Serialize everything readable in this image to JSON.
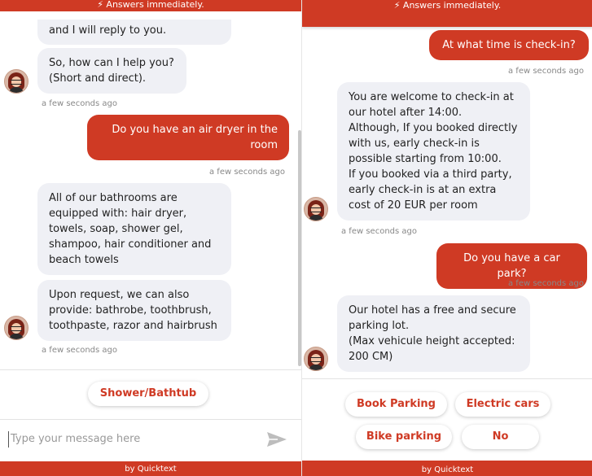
{
  "left": {
    "header": {
      "text": "⚡ Answers immediately."
    },
    "messages": {
      "bot_partial": "and I will reply to you.",
      "bot_help": "So, how can I help you?\n(Short and direct).",
      "time1": "a few seconds ago",
      "user_q": "Do you have an air dryer in the room",
      "time2": "a few seconds ago",
      "bot_bath": "All of our bathrooms are equipped with: hair dryer, towels, soap, shower gel, shampoo, hair conditioner and beach towels",
      "bot_request": "Upon request, we can also provide: bathrobe, toothbrush, toothpaste, razor and hairbrush",
      "time3": "a few seconds ago"
    },
    "quick_reply": "Shower/Bathtub",
    "input_placeholder": "Type your message here",
    "footer": "by Quicktext"
  },
  "right": {
    "header": {
      "text": "⚡ Answers immediately."
    },
    "messages": {
      "user_checkin": "At what time is check-in?",
      "time1": "a few seconds ago",
      "bot_checkin": "You are welcome to check-in at our hotel after 14:00.\nAlthough, If you booked directly with us, early check-in is possible starting from 10:00.\nIf you booked via a third party, early check-in is at an extra cost of 20 EUR per room",
      "time2": "a few seconds ago",
      "user_parking": "Do you have a car park?",
      "time3": "a few seconds ago",
      "bot_parking": "Our hotel has a free and secure parking lot.\n(Max vehicule height accepted: 200 CM)"
    },
    "quick_replies": [
      "Book Parking",
      "Electric cars",
      "Bike parking",
      "No"
    ],
    "footer": "by Quicktext"
  },
  "colors": {
    "brand": "#cf3a24",
    "bot_bubble": "#eff0f5"
  }
}
